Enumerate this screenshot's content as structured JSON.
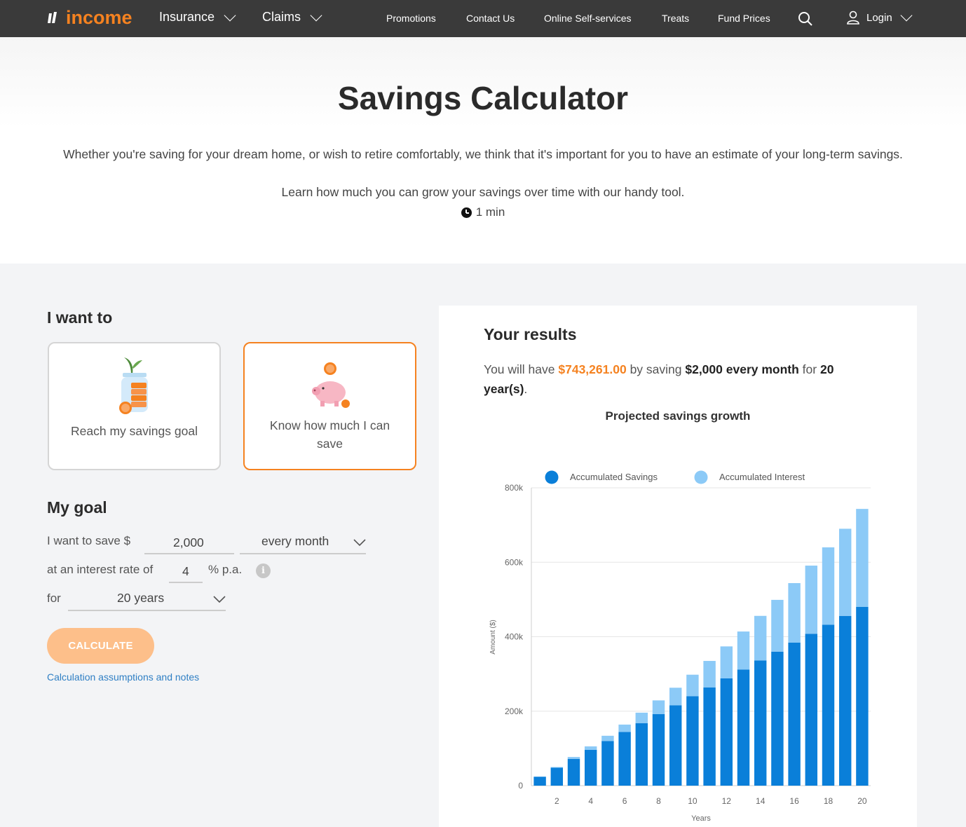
{
  "nav": {
    "logo_text": "income",
    "insurance": "Insurance",
    "claims": "Claims",
    "links": [
      "Promotions",
      "Contact Us",
      "Online Self-services",
      "Treats",
      "Fund Prices"
    ],
    "login": "Login"
  },
  "hero": {
    "title": "Savings Calculator",
    "intro": "Whether you're saving for your dream home, or wish to retire comfortably, we think that it's important for you to have an estimate of your long-term savings.",
    "sub": "Learn how much you can grow your savings over time with our handy tool.",
    "duration": "1 min"
  },
  "form": {
    "i_want_to": "I want to",
    "option_goal": "Reach my savings goal",
    "option_save": "Know how much I can save",
    "my_goal": "My goal",
    "save_label": "I want to save $",
    "amount": "2,000",
    "frequency": "every month",
    "rate_label": "at an interest rate of",
    "rate": "4",
    "rate_unit": "% p.a.",
    "for_label": "for",
    "duration": "20 years",
    "calculate": "CALCULATE",
    "notes_link": "Calculation assumptions and notes"
  },
  "results": {
    "title": "Your results",
    "s1": "You will have ",
    "total": "$743,261.00",
    "s2": " by saving ",
    "amount_freq": "$2,000 every month",
    "s3": " for ",
    "years": "20",
    "years_unit": "year(s)",
    "s4": ".",
    "chart_title": "Projected savings growth"
  },
  "colors": {
    "brand": "#f58220",
    "nav_bg": "#3a3a3a",
    "savings": "#0a7fd9",
    "interest": "#8ccaf7"
  },
  "chart_data": {
    "type": "bar",
    "stacked": true,
    "x": [
      1,
      2,
      3,
      4,
      5,
      6,
      7,
      8,
      9,
      10,
      11,
      12,
      13,
      14,
      15,
      16,
      17,
      18,
      19,
      20
    ],
    "xlabel": "Years",
    "ylabel": "Amount ($)",
    "ylim": [
      0,
      800000
    ],
    "yticks": [
      0,
      200000,
      400000,
      600000,
      800000
    ],
    "ytick_labels": [
      "0",
      "200k",
      "400k",
      "600k",
      "800k"
    ],
    "xtick_labels": [
      "2",
      "4",
      "6",
      "8",
      "10",
      "12",
      "14",
      "16",
      "18",
      "20"
    ],
    "legend": "top",
    "series": [
      {
        "name": "Accumulated Savings",
        "values": [
          24000,
          48000,
          72000,
          96000,
          120000,
          144000,
          168000,
          192000,
          216000,
          240000,
          264000,
          288000,
          312000,
          336000,
          360000,
          384000,
          408000,
          432000,
          456000,
          480000
        ]
      },
      {
        "name": "Accumulated Interest",
        "values": [
          500,
          2000,
          5000,
          9500,
          14000,
          20000,
          28000,
          37000,
          47000,
          58000,
          71000,
          86000,
          102000,
          120000,
          139000,
          160000,
          183000,
          208000,
          234000,
          263261
        ]
      }
    ]
  }
}
